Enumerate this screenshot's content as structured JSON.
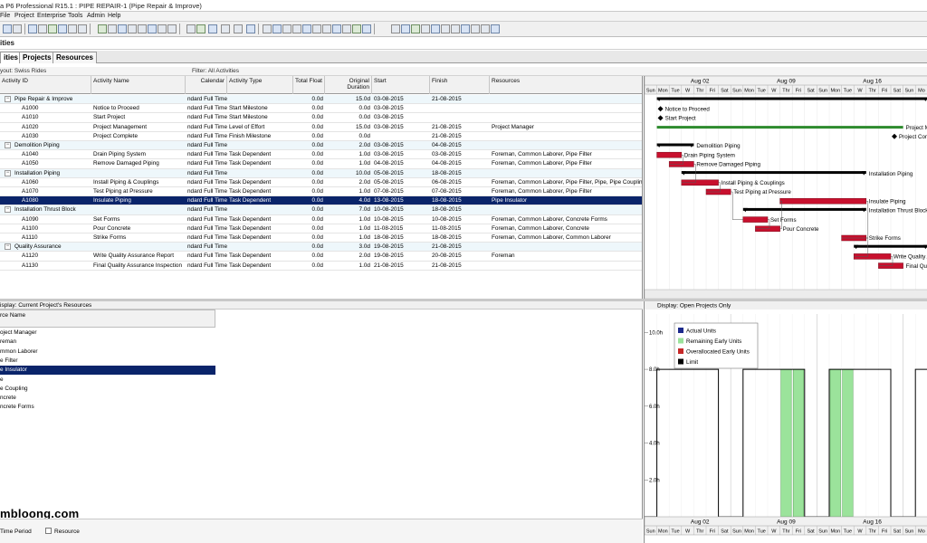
{
  "window": {
    "title": "a P6 Professional R15.1 : PIPE REPAIR-1 (Pipe Repair & Improve)"
  },
  "menu": [
    "File",
    "Project",
    "Enterprise",
    "Tools",
    "Admin",
    "Help"
  ],
  "section_title": "ities",
  "tabs": [
    {
      "label": "ities",
      "active": true
    },
    {
      "label": "Projects",
      "active": false
    },
    {
      "label": "Resources",
      "active": false
    }
  ],
  "layout_bar": {
    "layout": "yout: Swiss Rides",
    "filter": "Filter: All Activities"
  },
  "grid": {
    "columns": [
      "Activity ID",
      "Activity Name",
      "Calendar",
      "Activity Type",
      "Total Float",
      "Original Duration",
      "Start",
      "Finish",
      "Resources"
    ],
    "rows": [
      {
        "type": "wbs",
        "id": "Pipe Repair & Improve",
        "name": "",
        "cal": "ndard Full Time",
        "atype": "",
        "tf": "0.0d",
        "od": "15.0d",
        "start": "03-08-2015",
        "finish": "21-08-2015",
        "res": ""
      },
      {
        "type": "act",
        "id": "A1000",
        "name": "Notice to Proceed",
        "cal": "ndard Full Time",
        "atype": "Start Milestone",
        "tf": "0.0d",
        "od": "0.0d",
        "start": "03-08-2015",
        "finish": "",
        "res": ""
      },
      {
        "type": "act",
        "id": "A1010",
        "name": "Start Project",
        "cal": "ndard Full Time",
        "atype": "Start Milestone",
        "tf": "0.0d",
        "od": "0.0d",
        "start": "03-08-2015",
        "finish": "",
        "res": ""
      },
      {
        "type": "act",
        "id": "A1020",
        "name": "Project Management",
        "cal": "ndard Full Time",
        "atype": "Level of Effort",
        "tf": "0.0d",
        "od": "15.0d",
        "start": "03-08-2015",
        "finish": "21-08-2015",
        "res": "Project Manager"
      },
      {
        "type": "act",
        "id": "A1030",
        "name": "Project Complete",
        "cal": "ndard Full Time",
        "atype": "Finish Milestone",
        "tf": "0.0d",
        "od": "0.0d",
        "start": "",
        "finish": "21-08-2015",
        "res": ""
      },
      {
        "type": "wbs",
        "id": "Demolition Piping",
        "name": "",
        "cal": "ndard Full Time",
        "atype": "",
        "tf": "0.0d",
        "od": "2.0d",
        "start": "03-08-2015",
        "finish": "04-08-2015",
        "res": ""
      },
      {
        "type": "act",
        "id": "A1040",
        "name": "Drain Piping System",
        "cal": "ndard Full Time",
        "atype": "Task Dependent",
        "tf": "0.0d",
        "od": "1.0d",
        "start": "03-08-2015",
        "finish": "03-08-2015",
        "res": "Foreman, Common Laborer, Pipe Filter"
      },
      {
        "type": "act",
        "id": "A1050",
        "name": "Remove Damaged Piping",
        "cal": "ndard Full Time",
        "atype": "Task Dependent",
        "tf": "0.0d",
        "od": "1.0d",
        "start": "04-08-2015",
        "finish": "04-08-2015",
        "res": "Foreman, Common Laborer, Pipe Filter"
      },
      {
        "type": "wbs",
        "id": "Installation Piping",
        "name": "",
        "cal": "ndard Full Time",
        "atype": "",
        "tf": "0.0d",
        "od": "10.0d",
        "start": "05-08-2015",
        "finish": "18-08-2015",
        "res": ""
      },
      {
        "type": "act",
        "id": "A1060",
        "name": "Install Piping & Couplings",
        "cal": "ndard Full Time",
        "atype": "Task Dependent",
        "tf": "0.0d",
        "od": "2.0d",
        "start": "05-08-2015",
        "finish": "06-08-2015",
        "res": "Foreman, Common Laborer, Pipe Filter, Pipe, Pipe Coupling"
      },
      {
        "type": "act",
        "id": "A1070",
        "name": "Test Piping at Pressure",
        "cal": "ndard Full Time",
        "atype": "Task Dependent",
        "tf": "0.0d",
        "od": "1.0d",
        "start": "07-08-2015",
        "finish": "07-08-2015",
        "res": "Foreman, Common Laborer, Pipe Filter"
      },
      {
        "type": "sel",
        "id": "A1080",
        "name": "Insulate Piping",
        "cal": "ndard Full Time",
        "atype": "Task Dependent",
        "tf": "0.0d",
        "od": "4.0d",
        "start": "13-08-2015",
        "finish": "18-08-2015",
        "res": "Pipe Insulator"
      },
      {
        "type": "wbs",
        "id": "Installation Thrust Block",
        "name": "",
        "cal": "ndard Full Time",
        "atype": "",
        "tf": "0.0d",
        "od": "7.0d",
        "start": "10-08-2015",
        "finish": "18-08-2015",
        "res": ""
      },
      {
        "type": "act",
        "id": "A1090",
        "name": "Set Forms",
        "cal": "ndard Full Time",
        "atype": "Task Dependent",
        "tf": "0.0d",
        "od": "1.0d",
        "start": "10-08-2015",
        "finish": "10-08-2015",
        "res": "Foreman, Common Laborer, Concrete Forms"
      },
      {
        "type": "act",
        "id": "A1100",
        "name": "Pour Concrete",
        "cal": "ndard Full Time",
        "atype": "Task Dependent",
        "tf": "0.0d",
        "od": "1.0d",
        "start": "11-08-2015",
        "finish": "11-08-2015",
        "res": "Foreman, Common Laborer, Concrete"
      },
      {
        "type": "act",
        "id": "A1110",
        "name": "Strike Forms",
        "cal": "ndard Full Time",
        "atype": "Task Dependent",
        "tf": "0.0d",
        "od": "1.0d",
        "start": "18-08-2015",
        "finish": "18-08-2015",
        "res": "Foreman, Common Laborer, Common Laborer"
      },
      {
        "type": "wbs",
        "id": "Quality Assurance",
        "name": "",
        "cal": "ndard Full Time",
        "atype": "",
        "tf": "0.0d",
        "od": "3.0d",
        "start": "19-08-2015",
        "finish": "21-08-2015",
        "res": ""
      },
      {
        "type": "act",
        "id": "A1120",
        "name": "Write Quality Assurance Report",
        "cal": "ndard Full Time",
        "atype": "Task Dependent",
        "tf": "0.0d",
        "od": "2.0d",
        "start": "19-08-2015",
        "finish": "20-08-2015",
        "res": "Foreman"
      },
      {
        "type": "act",
        "id": "A1130",
        "name": "Final Quality Assurance Inspection",
        "cal": "ndard Full Time",
        "atype": "Task Dependent",
        "tf": "0.0d",
        "od": "1.0d",
        "start": "21-08-2015",
        "finish": "21-08-2015",
        "res": ""
      }
    ]
  },
  "gantt": {
    "weeks": [
      "Aug 02",
      "Aug 09",
      "Aug 16"
    ],
    "days": [
      "Sun",
      "Mon",
      "Tue",
      "W",
      "Thr",
      "Fri",
      "Sat",
      "Sun",
      "Mon",
      "Tue",
      "W",
      "Thr",
      "Fri",
      "Sat",
      "Sun",
      "Mon",
      "Tue",
      "W",
      "Thr",
      "Fri",
      "Sat",
      "Sun",
      "Mo"
    ],
    "bars": [
      {
        "row": 0,
        "kind": "summary",
        "start": 1,
        "end": 22,
        "label": "Pipe Repair"
      },
      {
        "row": 1,
        "kind": "milestone",
        "start": 1,
        "end": 1,
        "label": "Notice to Proceed"
      },
      {
        "row": 2,
        "kind": "milestone",
        "start": 1,
        "end": 1,
        "label": "Start Project"
      },
      {
        "row": 3,
        "kind": "loe",
        "start": 1,
        "end": 20,
        "label": "Project Man"
      },
      {
        "row": 4,
        "kind": "milestone",
        "start": 20,
        "end": 20,
        "label": "Project Com"
      },
      {
        "row": 5,
        "kind": "summary",
        "start": 1,
        "end": 3,
        "label": "Demolition Piping"
      },
      {
        "row": 6,
        "kind": "task",
        "start": 1,
        "end": 2,
        "label": "Drain Piping System"
      },
      {
        "row": 7,
        "kind": "task",
        "start": 2,
        "end": 3,
        "label": "Remove Damaged Piping"
      },
      {
        "row": 8,
        "kind": "summary",
        "start": 3,
        "end": 17,
        "label": "Installation Piping"
      },
      {
        "row": 9,
        "kind": "task",
        "start": 3,
        "end": 5,
        "label": "Install Piping & Couplings"
      },
      {
        "row": 10,
        "kind": "task",
        "start": 5,
        "end": 6,
        "label": "Test Piping at Pressure"
      },
      {
        "row": 11,
        "kind": "task",
        "start": 11,
        "end": 17,
        "label": "Insulate Piping"
      },
      {
        "row": 12,
        "kind": "summary",
        "start": 8,
        "end": 17,
        "label": "Installation Thrust Block"
      },
      {
        "row": 13,
        "kind": "task",
        "start": 8,
        "end": 9,
        "label": "Set Forms"
      },
      {
        "row": 14,
        "kind": "task",
        "start": 9,
        "end": 10,
        "label": "Pour Concrete"
      },
      {
        "row": 15,
        "kind": "task",
        "start": 16,
        "end": 17,
        "label": "Strike Forms"
      },
      {
        "row": 16,
        "kind": "summary",
        "start": 17,
        "end": 22,
        "label": "Quality Assu"
      },
      {
        "row": 17,
        "kind": "task",
        "start": 17,
        "end": 19,
        "label": "Write Quality Assura"
      },
      {
        "row": 18,
        "kind": "task",
        "start": 19,
        "end": 20,
        "label": "Final Quality"
      }
    ]
  },
  "resources": {
    "display": "isplay: Current Project's Resources",
    "header": "rce Name",
    "items": [
      {
        "label": "oject Manager",
        "selected": false
      },
      {
        "label": "reman",
        "selected": false
      },
      {
        "label": "mmon Laborer",
        "selected": false
      },
      {
        "label": "e Filter",
        "selected": false
      },
      {
        "label": "e Insulator",
        "selected": true
      },
      {
        "label": "e",
        "selected": false
      },
      {
        "label": "e Coupling",
        "selected": false
      },
      {
        "label": "ncrete",
        "selected": false
      },
      {
        "label": "ncrete Forms",
        "selected": false
      }
    ],
    "watermark": "mbloong.com",
    "footer": {
      "time_period": "Time Period",
      "resource": "Resource"
    }
  },
  "profile": {
    "display": "Display: Open Projects Only",
    "legend": [
      {
        "label": "Actual Units",
        "color": "#1c2a8c"
      },
      {
        "label": "Remaining Early Units",
        "color": "#9be39b"
      },
      {
        "label": "Overallocated Early Units",
        "color": "#c62828"
      },
      {
        "label": "Limit",
        "color": "#000000"
      }
    ],
    "y_ticks": [
      "10.0h",
      "8.0h",
      "6.0h",
      "4.0h",
      "2.0h"
    ],
    "y_max": 11,
    "limit": 8,
    "allocation": [
      0,
      0,
      0,
      0,
      0,
      0,
      0,
      0,
      0,
      0,
      0,
      8,
      8,
      0,
      0,
      8,
      8,
      0,
      0,
      0,
      0,
      0,
      0
    ],
    "limit_by_day": [
      0,
      8,
      8,
      8,
      8,
      8,
      0,
      0,
      8,
      8,
      8,
      8,
      8,
      0,
      0,
      8,
      8,
      8,
      8,
      8,
      0,
      0,
      8
    ],
    "weeks": [
      "Aug 02",
      "Aug 09",
      "Aug 16"
    ],
    "days": [
      "Sun",
      "Mon",
      "Tue",
      "W",
      "Thr",
      "Fri",
      "Sat",
      "Sun",
      "Mon",
      "Tue",
      "W",
      "Thr",
      "Fri",
      "Sat",
      "Sun",
      "Mon",
      "Tue",
      "W",
      "Thr",
      "Fri",
      "Sat",
      "Sun",
      "Mo"
    ]
  }
}
